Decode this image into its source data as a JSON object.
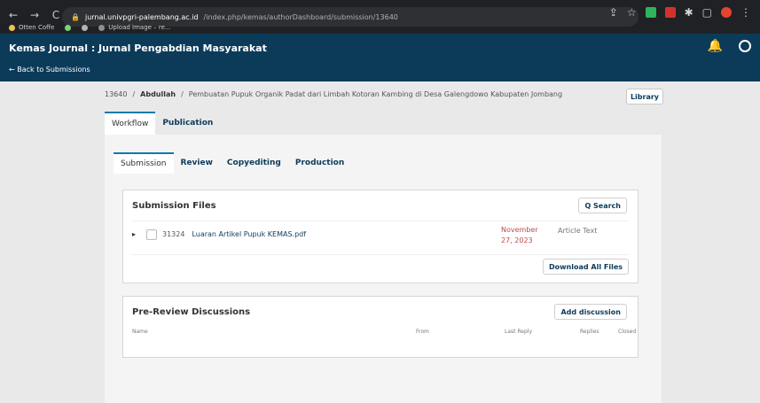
{
  "browser": {
    "nav": [
      "←",
      "→",
      "C"
    ],
    "url_host": "jurnal.univpgri-palembang.ac.id",
    "url_path": "/index.php/kemas/authorDashboard/submission/13640",
    "bookmarks": [
      "Otten Coffe",
      "Upload Image – re..."
    ],
    "extensions": [
      "share",
      "star",
      "ext-green",
      "ext-red",
      "puzzle",
      "tab",
      "profile",
      "menu"
    ]
  },
  "app": {
    "journal_title": "Kemas Journal : Jurnal Pengabdian Masyarakat",
    "back_label": "← Back to Submissions",
    "icons": [
      "bell-icon",
      "user-icon"
    ]
  },
  "submission": {
    "breadcrumb": {
      "id": "13640",
      "sep1": "/",
      "author": "Abdullah",
      "sep2": "/",
      "title": "Pembuatan Pupuk Organik Padat dari Limbah Kotoran Kambing di Desa Galengdowo Kabupaten Jombang"
    },
    "library_label": "Library",
    "tabs": [
      {
        "label": "Workflow",
        "active": true
      },
      {
        "label": "Publication",
        "active": false
      }
    ],
    "subtabs": [
      {
        "label": "Submission",
        "active": true
      },
      {
        "label": "Review",
        "active": false
      },
      {
        "label": "Copyediting",
        "active": false
      },
      {
        "label": "Production",
        "active": false
      }
    ]
  },
  "submission_files": {
    "title": "Submission Files",
    "search_label": "Q Search",
    "files": [
      {
        "id": "31324",
        "name": "Luaran Artikel Pupuk KEMAS.pdf",
        "date": "November\n27, 2023",
        "type": "Article Text"
      }
    ],
    "download_label": "Download All Files"
  },
  "discussions": {
    "title": "Pre-Review Discussions",
    "add_label": "Add discussion",
    "columns": [
      "Name",
      "From",
      "Last Reply",
      "Replies",
      "Closed"
    ]
  },
  "colors": {
    "chrome_bg": "#202124",
    "header_bg": "#0c3b5a",
    "accent": "#0c7aa8",
    "date_red": "#c04b4b"
  }
}
